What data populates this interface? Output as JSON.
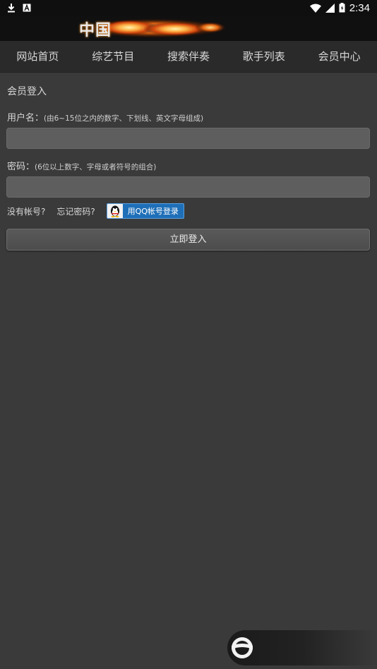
{
  "statusbar": {
    "time": "2:34",
    "icons": [
      "download-icon",
      "a-notification-icon",
      "wifi-icon",
      "signal-icon",
      "battery-icon"
    ]
  },
  "header": {
    "logo_text": "中国"
  },
  "nav": {
    "items": [
      {
        "label": "网站首页"
      },
      {
        "label": "综艺节目"
      },
      {
        "label": "搜索伴奏"
      },
      {
        "label": "歌手列表"
      },
      {
        "label": "会员中心"
      }
    ]
  },
  "login": {
    "title": "会员登入",
    "username_label": "用户名：",
    "username_hint": "(由6~15位之内的数字、下划线、英文字母组成)",
    "username_value": "",
    "password_label": "密码：",
    "password_hint": "(6位以上数字、字母或者符号的组合)",
    "password_value": "",
    "no_account_link": "没有帐号?",
    "forgot_link": "忘记密码?",
    "qq_login_label": "用QQ帐号登录",
    "submit_label": "立即登入"
  },
  "colors": {
    "background": "#3a3a3a",
    "nav_bg": "#2a2a2a",
    "input_bg": "#5e5e5e",
    "qq_blue": "#1e6fb8"
  }
}
